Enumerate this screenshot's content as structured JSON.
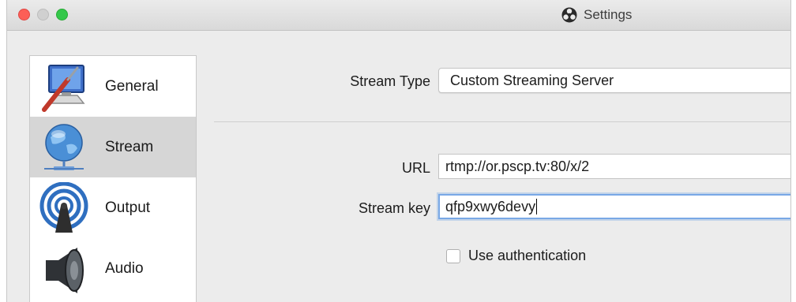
{
  "window": {
    "title": "Settings",
    "app_icon": "obs-logo-icon"
  },
  "sidebar": {
    "items": [
      {
        "label": "General",
        "icon": "computer-screwdriver-icon",
        "selected": false
      },
      {
        "label": "Stream",
        "icon": "globe-network-icon",
        "selected": true
      },
      {
        "label": "Output",
        "icon": "broadcast-antenna-icon",
        "selected": false
      },
      {
        "label": "Audio",
        "icon": "speaker-icon",
        "selected": false
      }
    ]
  },
  "stream": {
    "type_label": "Stream Type",
    "type_value": "Custom Streaming Server",
    "url_label": "URL",
    "url_value": "rtmp://or.pscp.tv:80/x/2",
    "key_label": "Stream key",
    "key_value": "qfp9xwy6devy",
    "auth_label": "Use authentication",
    "auth_checked": false
  },
  "colors": {
    "close": "#fc5f57",
    "minimize": "#d0d0d0",
    "maximize": "#34c84a",
    "selected_row": "#d6d6d6",
    "focus_ring": "#79a8e6"
  }
}
